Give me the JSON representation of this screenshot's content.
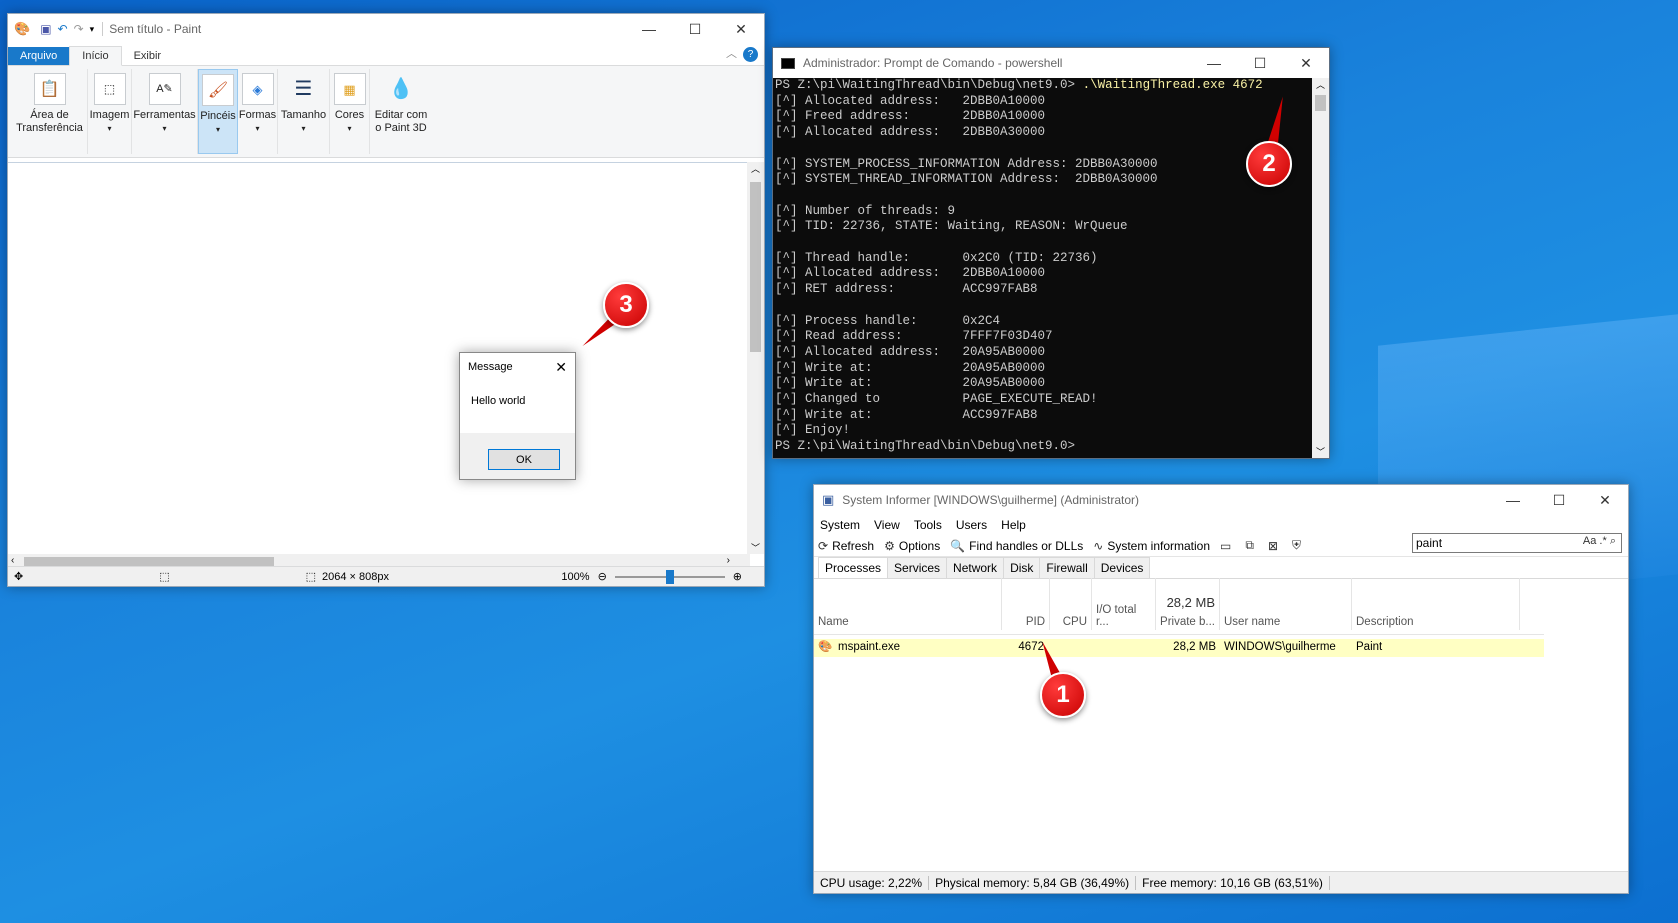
{
  "paint": {
    "title": "Sem título - Paint",
    "tabs": [
      "Arquivo",
      "Início",
      "Exibir"
    ],
    "groups": [
      {
        "label": "Área de\nTransferência",
        "icon": "clipboard-icon"
      },
      {
        "label": "Imagem",
        "icon": "select-icon"
      },
      {
        "label": "Ferramentas",
        "icon": "tools-icon"
      },
      {
        "label": "Pincéis",
        "icon": "brush-icon"
      },
      {
        "label": "Formas",
        "icon": "shapes-icon"
      },
      {
        "label": "Tamanho",
        "icon": "size-icon"
      },
      {
        "label": "Cores",
        "icon": "colors-icon"
      },
      {
        "label": "Editar com\no Paint 3D",
        "icon": "paint3d-icon"
      }
    ],
    "dimensions": "2064 × 808px",
    "zoom": "100%",
    "zoom_level": 0.5
  },
  "message": {
    "title": "Message",
    "body": "Hello world",
    "ok": "OK"
  },
  "console": {
    "title": "Administrador: Prompt de Comando - powershell",
    "command_prompt": "PS Z:\\pi\\WaitingThread\\bin\\Debug\\net9.0> ",
    "command": ".\\WaitingThread.exe 4672",
    "lines": [
      "[^] Allocated address:   2DBB0A10000",
      "[^] Freed address:       2DBB0A10000",
      "[^] Allocated address:   2DBB0A30000",
      "",
      "[^] SYSTEM_PROCESS_INFORMATION Address: 2DBB0A30000",
      "[^] SYSTEM_THREAD_INFORMATION Address:  2DBB0A30000",
      "",
      "[^] Number of threads: 9",
      "[^] TID: 22736, STATE: Waiting, REASON: WrQueue",
      "",
      "[^] Thread handle:       0x2C0 (TID: 22736)",
      "[^] Allocated address:   2DBB0A10000",
      "[^] RET address:         ACC997FAB8",
      "",
      "[^] Process handle:      0x2C4",
      "[^] Read address:        7FFF7F03D407",
      "[^] Allocated address:   20A95AB0000",
      "[^] Write at:            20A95AB0000",
      "[^] Write at:            20A95AB0000",
      "[^] Changed to           PAGE_EXECUTE_READ!",
      "[^] Write at:            ACC997FAB8",
      "[^] Enjoy!",
      "PS Z:\\pi\\WaitingThread\\bin\\Debug\\net9.0>"
    ]
  },
  "sysinf": {
    "title": "System Informer [WINDOWS\\guilherme] (Administrator)",
    "menu": [
      "System",
      "View",
      "Tools",
      "Users",
      "Help"
    ],
    "toolbar": {
      "refresh": "Refresh",
      "options": "Options",
      "find": "Find handles or DLLs",
      "sysinfo": "System information"
    },
    "search": "paint",
    "search_opts": "Aa .*",
    "tabs": [
      "Processes",
      "Services",
      "Network",
      "Disk",
      "Firewall",
      "Devices"
    ],
    "columns": {
      "name": "Name",
      "pid": "PID",
      "cpu": "CPU",
      "io": "I/O total r...",
      "private_total": "28,2 MB",
      "private": "Private b...",
      "user": "User name",
      "desc": "Description"
    },
    "row": {
      "name": "mspaint.exe",
      "pid": "4672",
      "private": "28,2 MB",
      "user": "WINDOWS\\guilherme",
      "desc": "Paint"
    },
    "status": {
      "cpu": "CPU usage: 2,22%",
      "phys": "Physical memory: 5,84 GB (36,49%)",
      "free": "Free memory: 10,16 GB (63,51%)"
    }
  },
  "callouts": [
    "1",
    "2",
    "3"
  ]
}
